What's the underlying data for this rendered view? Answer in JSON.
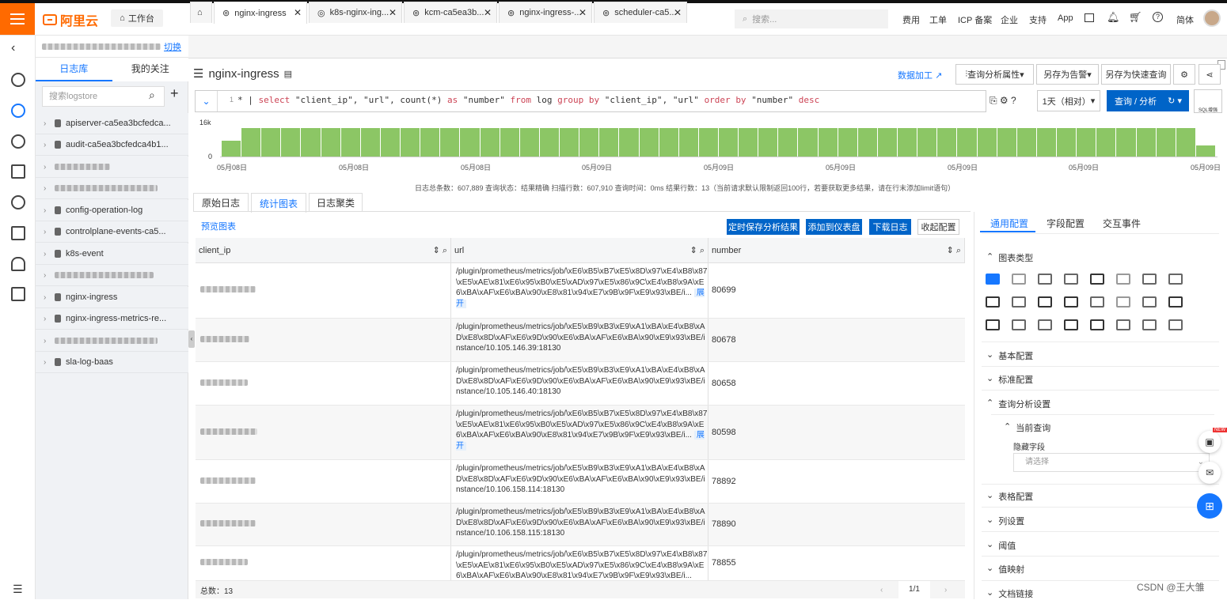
{
  "topbar": {
    "brand": "阿里云",
    "workbench": "工作台",
    "search_placeholder": "搜索...",
    "nav": [
      "费用",
      "工单",
      "ICP 备案",
      "企业",
      "支持",
      "App"
    ],
    "lang": "简体"
  },
  "breadcrumb": {
    "switch": "切换"
  },
  "sidebar": {
    "tabs": [
      "日志库",
      "我的关注"
    ],
    "search_placeholder": "搜索logstore",
    "items": [
      "apiserver-ca5ea3bcfedca...",
      "audit-ca5ea3bcfedca4b1...",
      "",
      "",
      "config-operation-log",
      "controlplane-events-ca5...",
      "k8s-event",
      "",
      "nginx-ingress",
      "nginx-ingress-metrics-re...",
      "",
      "sla-log-baas"
    ]
  },
  "tabs": [
    "nginx-ingress",
    "k8s-nginx-ing...",
    "kcm-ca5ea3b...",
    "nginx-ingress-...",
    "scheduler-ca5..."
  ],
  "logstore": {
    "title": "nginx-ingress"
  },
  "toolbar": {
    "data_process": "数据加工",
    "query_props": "查询分析属性",
    "save_alert": "另存为告警",
    "save_quick": "另存为快速查询"
  },
  "query": {
    "line_no": "1",
    "time_range": "1天（相对）",
    "search_btn": "查询 / 分析",
    "sql_label": "SQL增强"
  },
  "histogram": {
    "ymax": "16k",
    "ymin": "0",
    "xlabels": [
      "05月08日",
      "05月08日",
      "05月08日",
      "05月09日",
      "05月09日",
      "05月09日",
      "05月09日",
      "05月09日",
      "05月09日"
    ],
    "bars": [
      0.55,
      1,
      1,
      1,
      1,
      1,
      1,
      1,
      1,
      1,
      1,
      1,
      1,
      1,
      1,
      1,
      1,
      1,
      1,
      1,
      1,
      1,
      1,
      1,
      1,
      1,
      1,
      1,
      1,
      1,
      1,
      1,
      1,
      1,
      1,
      1,
      1,
      1,
      1,
      1,
      1,
      1,
      1,
      1,
      1,
      1,
      1,
      1,
      1,
      0.4
    ]
  },
  "stats": "日志总条数：607,889  查询状态：结果精确  扫描行数：607,910  查询时间：0ms  结果行数：13（当前请求默认限制返回100行，若要获取更多结果，请在行末添加limit语句）",
  "view_tabs": [
    "原始日志",
    "统计图表",
    "日志聚类"
  ],
  "chart_actions": {
    "preview": "预览图表",
    "save_schedule": "定时保存分析结果",
    "add_dashboard": "添加到仪表盘",
    "download": "下载日志",
    "collapse": "收起配置"
  },
  "table": {
    "headers": [
      "client_ip",
      "url",
      "number"
    ],
    "rows": [
      {
        "url": "/plugin/prometheus/metrics/job/\\xE6\\xB5\\xB7\\xE5\\x8D\\x97\\xE4\\xB8\\x87\\xE5\\xAE\\x81\\xE6\\x95\\xB0\\xE5\\xAD\\x97\\xE5\\x86\\x9C\\xE4\\xB8\\x9A\\xE6\\xBA\\xAF\\xE6\\xBA\\x90\\xE8\\x81\\x94\\xE7\\x9B\\x9F\\xE9\\x93\\xBE/i...",
        "expand": "展开",
        "number": "80699"
      },
      {
        "url": "/plugin/prometheus/metrics/job/\\xE5\\xB9\\xB3\\xE9\\xA1\\xBA\\xE4\\xB8\\xAD\\xE8\\x8D\\xAF\\xE6\\x9D\\x90\\xE6\\xBA\\xAF\\xE6\\xBA\\x90\\xE9\\x93\\xBE/instance/10.105.146.39:18130",
        "expand": "",
        "number": "80678"
      },
      {
        "url": "/plugin/prometheus/metrics/job/\\xE5\\xB9\\xB3\\xE9\\xA1\\xBA\\xE4\\xB8\\xAD\\xE8\\x8D\\xAF\\xE6\\x9D\\x90\\xE6\\xBA\\xAF\\xE6\\xBA\\x90\\xE9\\x93\\xBE/instance/10.105.146.40:18130",
        "expand": "",
        "number": "80658"
      },
      {
        "url": "/plugin/prometheus/metrics/job/\\xE6\\xB5\\xB7\\xE5\\x8D\\x97\\xE4\\xB8\\x87\\xE5\\xAE\\x81\\xE6\\x95\\xB0\\xE5\\xAD\\x97\\xE5\\x86\\x9C\\xE4\\xB8\\x9A\\xE6\\xBA\\xAF\\xE6\\xBA\\x90\\xE8\\x81\\x94\\xE7\\x9B\\x9F\\xE9\\x93\\xBE/i...",
        "expand": "展开",
        "number": "80598"
      },
      {
        "url": "/plugin/prometheus/metrics/job/\\xE5\\xB9\\xB3\\xE9\\xA1\\xBA\\xE4\\xB8\\xAD\\xE8\\x8D\\xAF\\xE6\\x9D\\x90\\xE6\\xBA\\xAF\\xE6\\xBA\\x90\\xE9\\x93\\xBE/instance/10.106.158.114:18130",
        "expand": "",
        "number": "78892"
      },
      {
        "url": "/plugin/prometheus/metrics/job/\\xE5\\xB9\\xB3\\xE9\\xA1\\xBA\\xE4\\xB8\\xAD\\xE8\\x8D\\xAF\\xE6\\x9D\\x90\\xE6\\xBA\\xAF\\xE6\\xBA\\x90\\xE9\\x93\\xBE/instance/10.106.158.115:18130",
        "expand": "",
        "number": "78890"
      },
      {
        "url": "/plugin/prometheus/metrics/job/\\xE6\\xB5\\xB7\\xE5\\x8D\\x97\\xE4\\xB8\\x87\\xE5\\xAE\\x81\\xE6\\x95\\xB0\\xE5\\xAD\\x97\\xE5\\x86\\x9C\\xE4\\xB8\\x9A\\xE6\\xBA\\xAF\\xE6\\xBA\\x90\\xE8\\x81\\x94\\xE7\\x9B\\x9F\\xE9\\x93\\xBE/i...",
        "expand": "",
        "number": "78855"
      }
    ],
    "total": "总数：13",
    "page": "1/1"
  },
  "config": {
    "tabs": [
      "通用配置",
      "字段配置",
      "交互事件"
    ],
    "chart_type": "图表类型",
    "sections": [
      "基本配置",
      "标准配置",
      "查询分析设置"
    ],
    "current_query": "当前查询",
    "hidden_fields": "隐藏字段",
    "select_placeholder": "请选择",
    "more": [
      "表格配置",
      "列设置",
      "阈值",
      "值映射",
      "文档链接"
    ]
  },
  "watermark": "CSDN @王大雏"
}
